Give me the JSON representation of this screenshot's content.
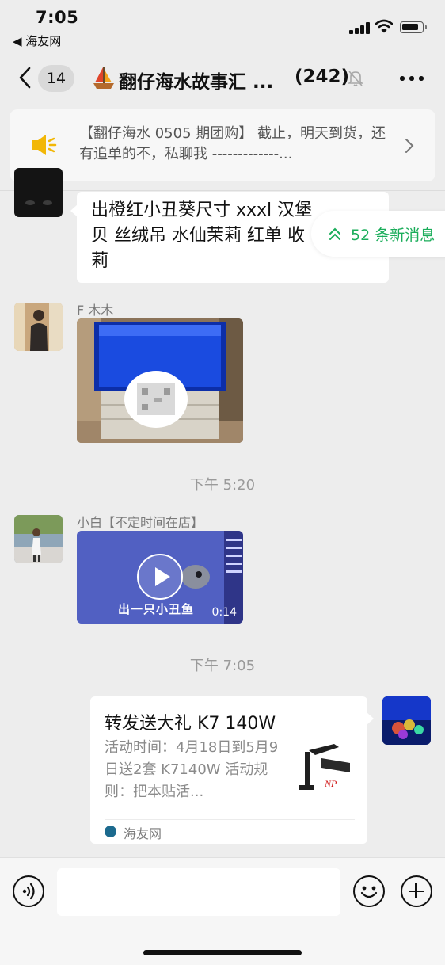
{
  "status_bar": {
    "time": "7:05",
    "back_app": "◀ 海友网"
  },
  "nav": {
    "unread_badge": "14",
    "title": "翻仔海水故事汇 ...",
    "member_count": "(242)",
    "icons": [
      "chevron-left-icon",
      "sailboat-icon",
      "mute-bell-icon",
      "more-icon"
    ]
  },
  "notice": {
    "text": "【翻仔海水 0505 期团购】 截止，明天到货，还有追单的不，私聊我 -------------..."
  },
  "new_messages": {
    "label": "52 条新消息"
  },
  "messages": [
    {
      "type": "text",
      "text": "出橙红小丑葵尺寸 xxxl 汉堡贝 丝绒吊 水仙茉莉 红单 收 莉"
    },
    {
      "type": "image",
      "sender": "F 木木"
    },
    {
      "type": "time",
      "text": "下午 5:20"
    },
    {
      "type": "video",
      "sender": "小白【不定时间在店】",
      "duration": "0:14",
      "caption": "出一只小丑鱼"
    },
    {
      "type": "time",
      "text": "下午 7:05"
    },
    {
      "type": "link",
      "title": "转发送大礼 K7 140W",
      "description": "活动时间：4月18日到5月9日送2套 K7140W 活动规则：把本贴活...",
      "source": "海友网"
    }
  ],
  "input_bar": {
    "placeholder": ""
  },
  "colors": {
    "background": "#ededed",
    "accent_green": "#1aad5a",
    "notice_speaker": "#f2b707"
  }
}
